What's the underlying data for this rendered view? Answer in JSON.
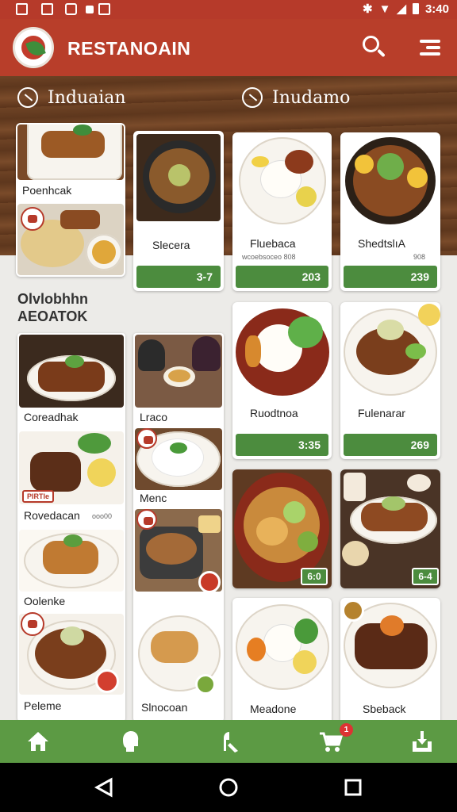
{
  "status_bar": {
    "time": "3:40"
  },
  "app_bar": {
    "title": "RESTANOAIN"
  },
  "categories": [
    {
      "label": "Induaian"
    },
    {
      "label": "Inudamo"
    }
  ],
  "section": {
    "title_line1": "Olvlobhhn",
    "title_line2": "AEOATOK"
  },
  "top_items": [
    {
      "name": "Slecera",
      "sub": "",
      "price": "3-7"
    },
    {
      "name": "Fluebaca",
      "sub": "wcoebsoceo 808",
      "price": "203"
    },
    {
      "name": "ShedtslıA",
      "sub": "908",
      "price": "239"
    }
  ],
  "mid_items": [
    {
      "name": "Ruodtnoa",
      "price": "3:35"
    },
    {
      "name": "Fulenarar",
      "price": "269"
    },
    {
      "name": "",
      "price": "6:0"
    },
    {
      "name": "",
      "price": "6-4"
    },
    {
      "name": "Meadone",
      "price": ""
    },
    {
      "name": "Sbeback",
      "price": ""
    }
  ],
  "left_items": [
    {
      "name": "Poenhcak"
    },
    {
      "name": "Coreadhak"
    },
    {
      "name": "Rovedacan",
      "sub": "ooo00",
      "tag": "PIRTIe"
    },
    {
      "name": "Oolenke"
    },
    {
      "name": "Peleme"
    }
  ],
  "second_col_items": [
    {
      "name": "Lraco"
    },
    {
      "name": "Menc"
    },
    {
      "name": "Slnocoan"
    }
  ],
  "bottom_nav": {
    "cart_count": "1"
  },
  "colors": {
    "primary_red": "#b83e2a",
    "accent_green": "#4c8c3e",
    "nav_green": "#5c9a44"
  }
}
